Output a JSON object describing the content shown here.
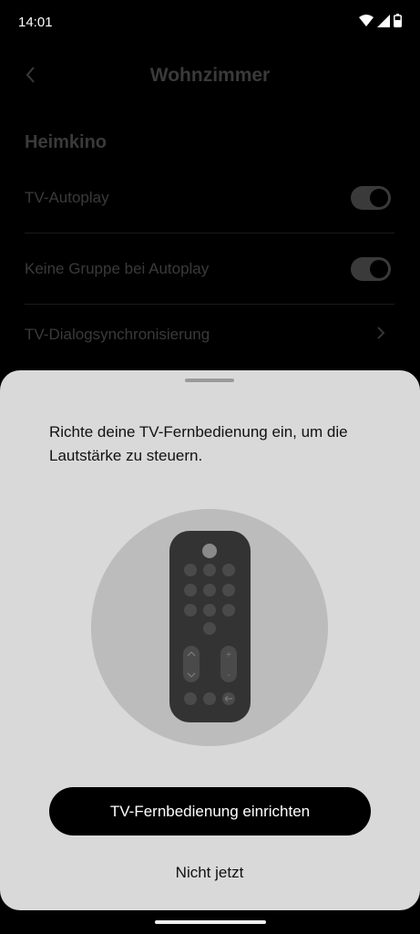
{
  "status": {
    "time": "14:01"
  },
  "header": {
    "title": "Wohnzimmer"
  },
  "section_title": "Heimkino",
  "settings": [
    {
      "label": "TV-Autoplay",
      "control": "toggle",
      "on": true
    },
    {
      "label": "Keine Gruppe bei Autoplay",
      "control": "toggle",
      "on": true
    },
    {
      "label": "TV-Dialogsynchronisierung",
      "control": "chevron"
    }
  ],
  "sheet": {
    "message": "Richte deine TV-Fernbedienung ein, um die Lautstärke zu steuern.",
    "primary_label": "TV-Fernbedienung einrichten",
    "secondary_label": "Nicht jetzt"
  },
  "remote_labels": {
    "vol_plus": "+",
    "vol_minus": "-"
  }
}
